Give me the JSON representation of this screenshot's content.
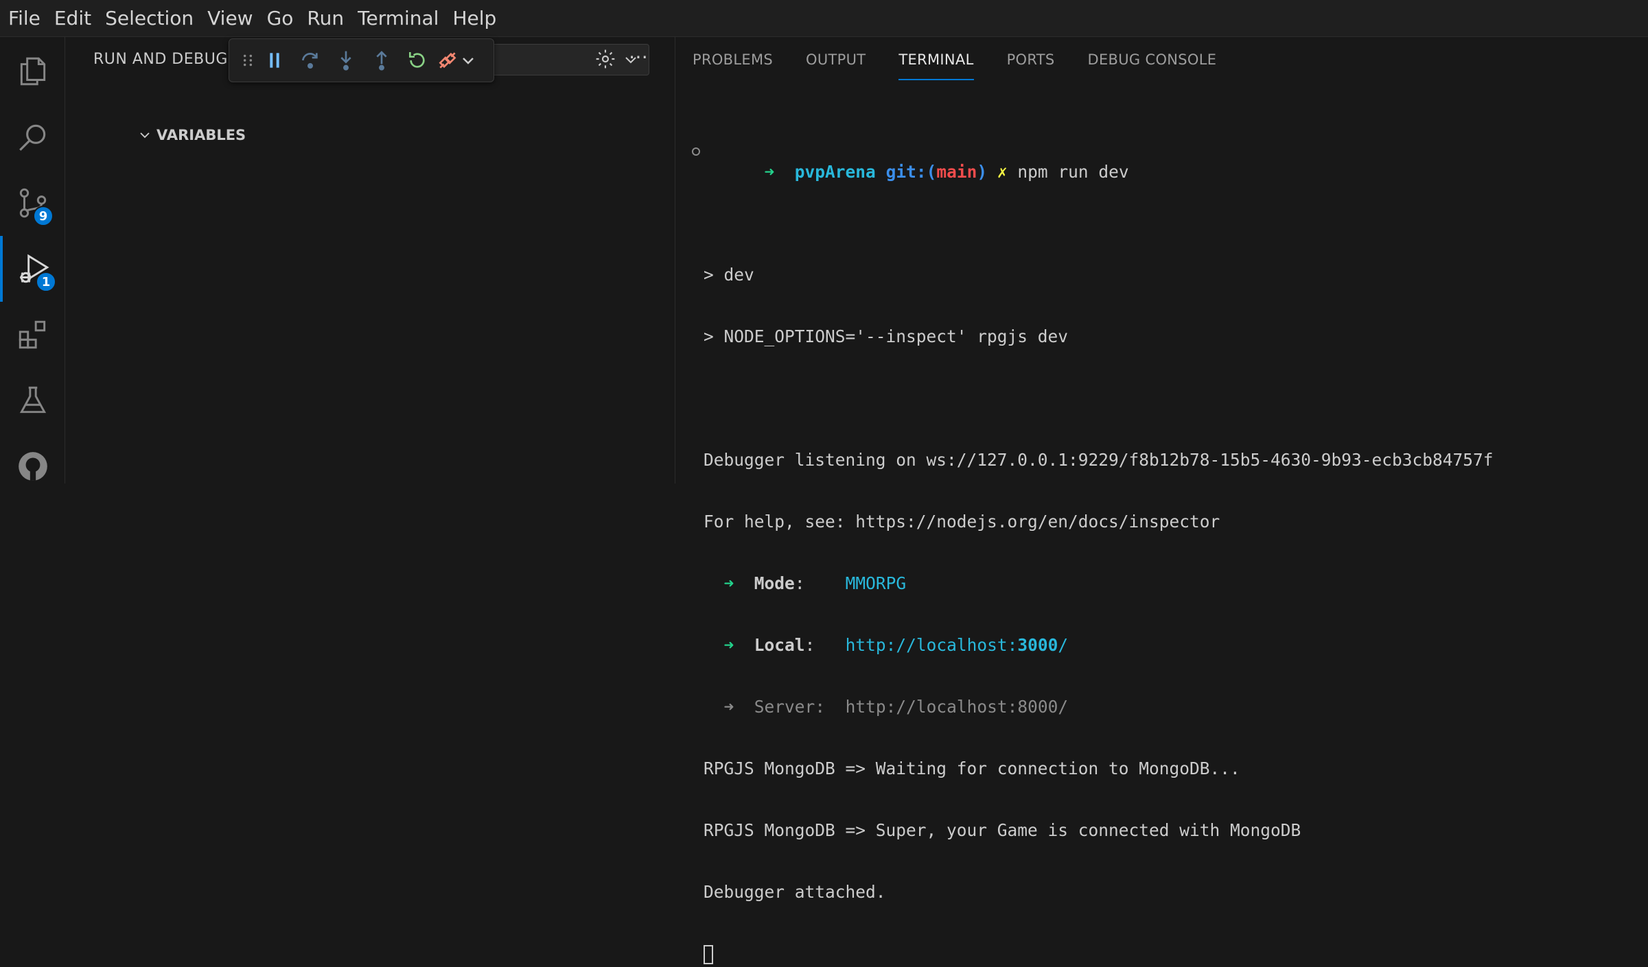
{
  "menu": [
    "File",
    "Edit",
    "Selection",
    "View",
    "Go",
    "Run",
    "Terminal",
    "Help"
  ],
  "activity": {
    "scm_badge": "9",
    "debug_badge": "1"
  },
  "sidebar": {
    "title": "RUN AND DEBUG",
    "variables_label": "VARIABLES"
  },
  "panel": {
    "tabs": [
      "PROBLEMS",
      "OUTPUT",
      "TERMINAL",
      "PORTS",
      "DEBUG CONSOLE"
    ],
    "active_tab": "TERMINAL"
  },
  "terminal": {
    "prompt_arrow": "➜",
    "prompt_dir": "pvpArena",
    "prompt_git": "git:(",
    "prompt_branch": "main",
    "prompt_git_close": ")",
    "prompt_dirty": "✗",
    "command": "npm run dev",
    "line_dev": "> dev",
    "line_node": "> NODE_OPTIONS='--inspect' rpgjs dev",
    "line_debugger": "Debugger listening on ws://127.0.0.1:9229/f8b12b78-15b5-4630-9b93-ecb3cb84757f",
    "line_help": "For help, see: https://nodejs.org/en/docs/inspector",
    "mode_label": "Mode",
    "mode_value": "MMORPG",
    "local_label": "Local",
    "local_url_prefix": "http://localhost:",
    "local_url_port": "3000",
    "local_url_suffix": "/",
    "server_label": "Server",
    "server_url": "http://localhost:8000/",
    "line_mongo_wait": "RPGJS MongoDB => Waiting for connection to MongoDB...",
    "line_mongo_ok": "RPGJS MongoDB => Super, your Game is connected with MongoDB",
    "line_attached": "Debugger attached."
  },
  "colors": {
    "accent": "#0078d4",
    "terminal_green": "#23d18b",
    "terminal_cyan": "#29b8db",
    "terminal_red": "#f14c4c",
    "terminal_yellow": "#f5f543"
  }
}
